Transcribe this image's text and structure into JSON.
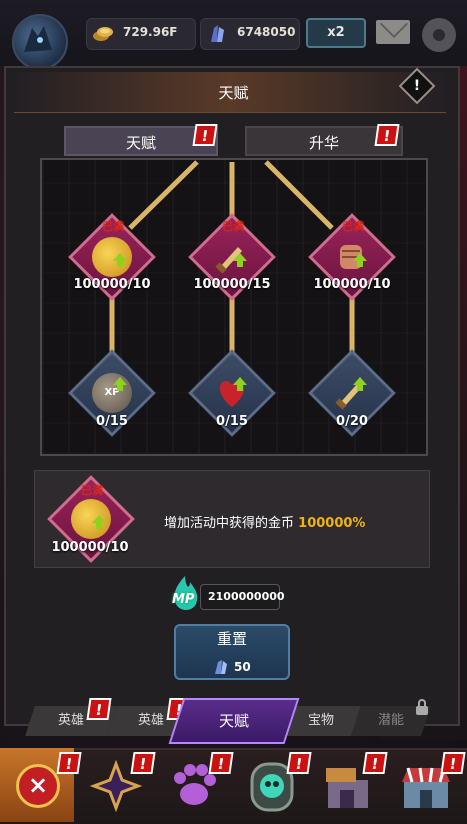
{
  "topbar": {
    "coins": "729.96F",
    "gems": "6748050",
    "multiplier": "x2"
  },
  "panel": {
    "title": "天赋",
    "info_mark": "!"
  },
  "subtabs": [
    {
      "label": "天赋",
      "badge": "!"
    },
    {
      "label": "升华",
      "badge": "!"
    }
  ],
  "nodes": {
    "row1": [
      {
        "max": "已满",
        "level": "100000/10"
      },
      {
        "max": "已满",
        "level": "100000/15"
      },
      {
        "max": "已满",
        "level": "100000/10"
      }
    ],
    "row2": [
      {
        "level": "0/15",
        "icon_text": "XP"
      },
      {
        "level": "0/15"
      },
      {
        "level": "0/20"
      }
    ]
  },
  "detail": {
    "max": "已满",
    "level": "100000/10",
    "text": "增加活动中获得的金币",
    "percent": "100000%"
  },
  "mp": {
    "label": "MP",
    "value": "2100000000"
  },
  "reset": {
    "label": "重置",
    "cost": "50"
  },
  "bottom_tabs": [
    {
      "label": "英雄",
      "badge": "!"
    },
    {
      "label": "英雄",
      "badge": "!"
    },
    {
      "label": "天赋"
    },
    {
      "label": "宝物"
    },
    {
      "label": "潜能"
    }
  ],
  "nav_badges": [
    "!",
    "!",
    "!",
    "!",
    "!",
    "!"
  ],
  "colors": {
    "accent_gold": "#f0b313",
    "max_red": "#d8261d",
    "badge_red": "#cc1111",
    "arrow_green": "#8fd21e"
  }
}
